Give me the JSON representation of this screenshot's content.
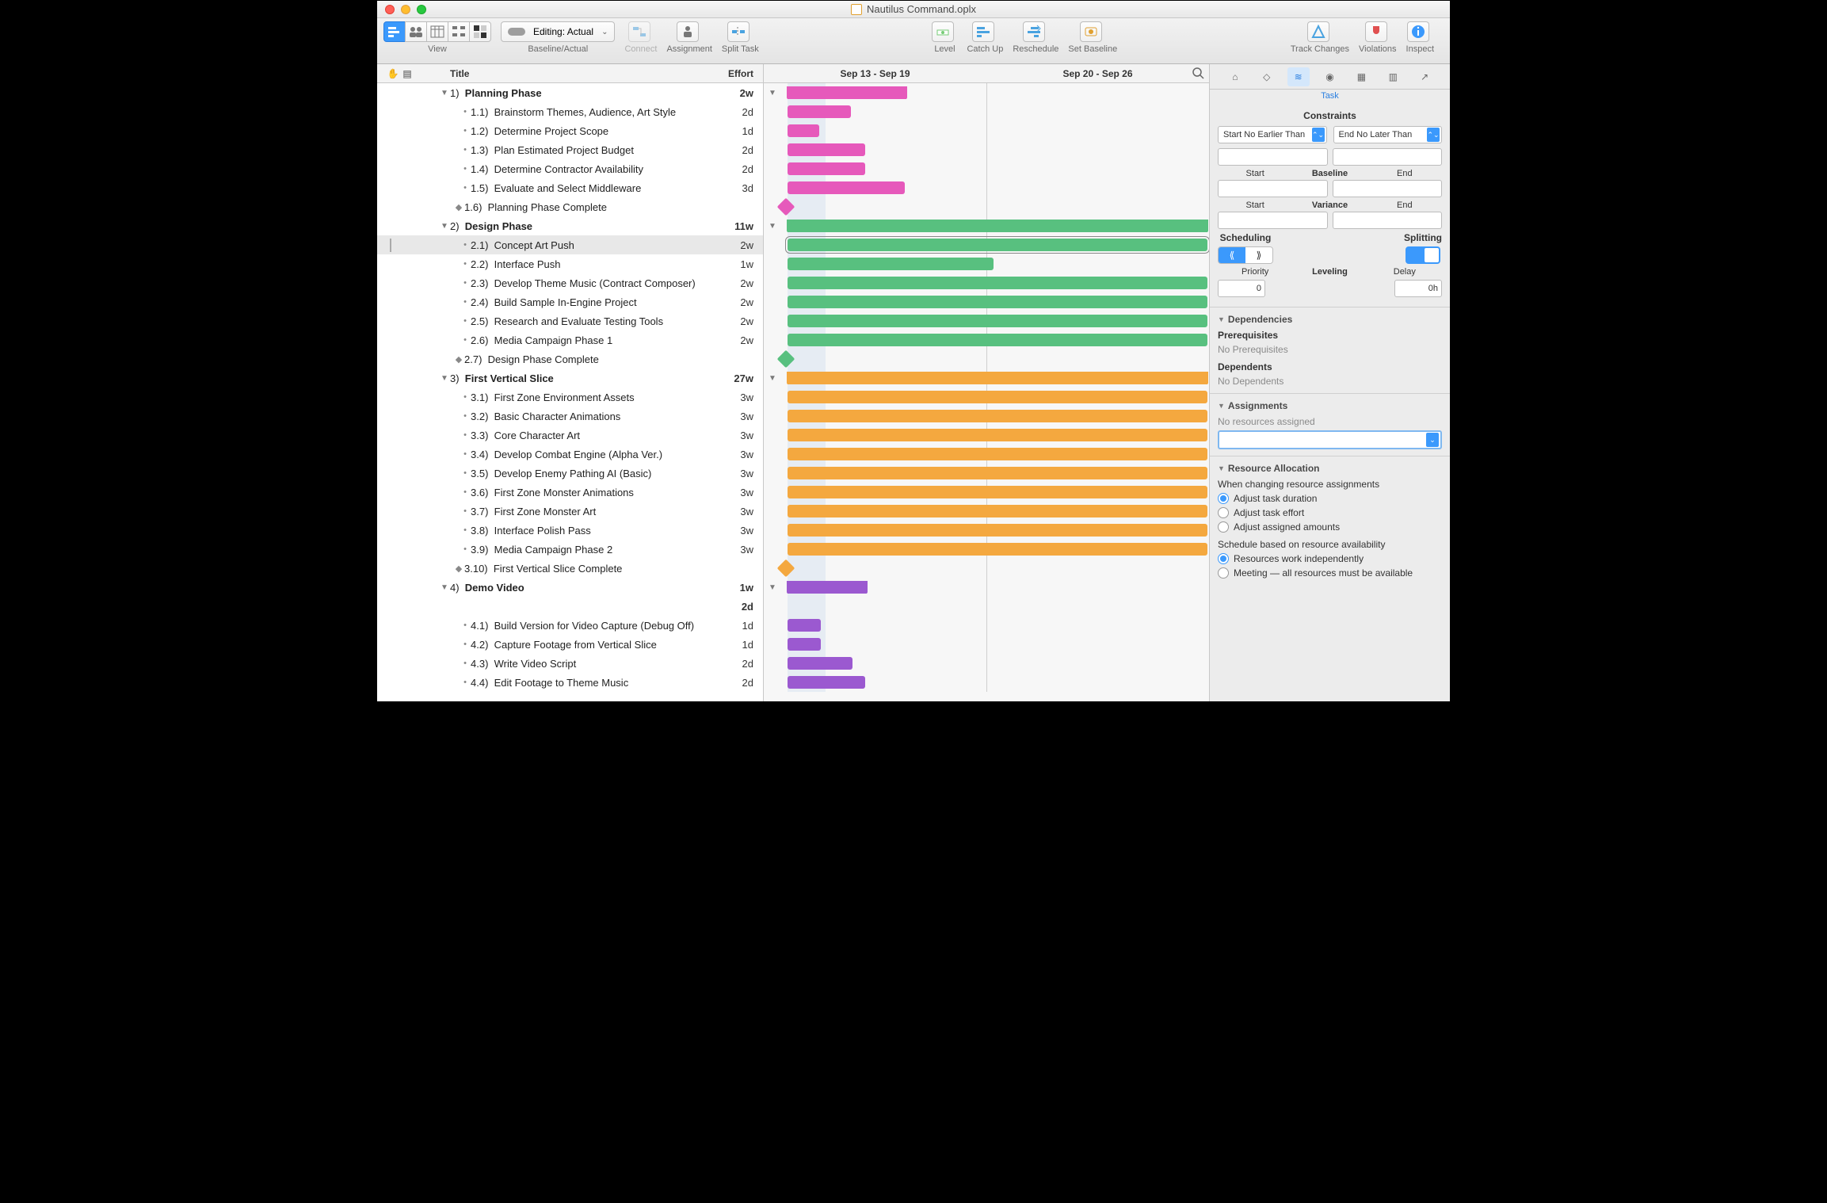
{
  "window": {
    "title": "Nautilus Command.oplx"
  },
  "toolbar": {
    "view_label": "View",
    "baseline_label": "Baseline/Actual",
    "editing_label": "Editing: Actual",
    "connect": "Connect",
    "assignment": "Assignment",
    "split_task": "Split Task",
    "level": "Level",
    "catch_up": "Catch Up",
    "reschedule": "Reschedule",
    "set_baseline": "Set Baseline",
    "track_changes": "Track Changes",
    "violations": "Violations",
    "inspect": "Inspect"
  },
  "outline_header": {
    "title": "Title",
    "effort": "Effort"
  },
  "gantt_header": {
    "left": "Sep 13 - Sep 19",
    "right": "Sep 20 - Sep 26"
  },
  "tasks": [
    {
      "type": "group",
      "num": "1)",
      "title": "Planning Phase",
      "effort": "2w",
      "color": "pink",
      "barStart": 30,
      "barEnd": 180
    },
    {
      "type": "task",
      "num": "1.1)",
      "title": "Brainstorm Themes, Audience, Art Style",
      "effort": "2d",
      "color": "pink",
      "barStart": 30,
      "barEnd": 110
    },
    {
      "type": "task",
      "num": "1.2)",
      "title": "Determine Project Scope",
      "effort": "1d",
      "color": "pink",
      "barStart": 30,
      "barEnd": 70
    },
    {
      "type": "task",
      "num": "1.3)",
      "title": "Plan Estimated Project Budget",
      "effort": "2d",
      "color": "pink",
      "barStart": 30,
      "barEnd": 128
    },
    {
      "type": "task",
      "num": "1.4)",
      "title": "Determine Contractor Availability",
      "effort": "2d",
      "color": "pink",
      "barStart": 30,
      "barEnd": 128
    },
    {
      "type": "task",
      "num": "1.5)",
      "title": "Evaluate and Select Middleware",
      "effort": "3d",
      "color": "pink",
      "barStart": 30,
      "barEnd": 178
    },
    {
      "type": "milestone",
      "num": "1.6)",
      "title": "Planning Phase Complete",
      "effort": "",
      "color": "pink",
      "barStart": 20
    },
    {
      "type": "group",
      "num": "2)",
      "title": "Design Phase",
      "effort": "11w",
      "color": "green",
      "barStart": 30,
      "barEnd": 560
    },
    {
      "type": "task",
      "num": "2.1)",
      "title": "Concept Art Push",
      "effort": "2w",
      "color": "green",
      "barStart": 30,
      "barEnd": 560,
      "selected": true,
      "note": true
    },
    {
      "type": "task",
      "num": "2.2)",
      "title": "Interface Push",
      "effort": "1w",
      "color": "green",
      "barStart": 30,
      "barEnd": 290
    },
    {
      "type": "task",
      "num": "2.3)",
      "title": "Develop Theme Music (Contract Composer)",
      "effort": "2w",
      "color": "green",
      "barStart": 30,
      "barEnd": 560
    },
    {
      "type": "task",
      "num": "2.4)",
      "title": "Build Sample In-Engine Project",
      "effort": "2w",
      "color": "green",
      "barStart": 30,
      "barEnd": 560
    },
    {
      "type": "task",
      "num": "2.5)",
      "title": "Research and Evaluate Testing Tools",
      "effort": "2w",
      "color": "green",
      "barStart": 30,
      "barEnd": 560
    },
    {
      "type": "task",
      "num": "2.6)",
      "title": "Media Campaign Phase 1",
      "effort": "2w",
      "color": "green",
      "barStart": 30,
      "barEnd": 560
    },
    {
      "type": "milestone",
      "num": "2.7)",
      "title": "Design Phase Complete",
      "effort": "",
      "color": "green",
      "barStart": 20
    },
    {
      "type": "group",
      "num": "3)",
      "title": "First Vertical Slice",
      "effort": "27w",
      "color": "orange",
      "barStart": 30,
      "barEnd": 560
    },
    {
      "type": "task",
      "num": "3.1)",
      "title": "First Zone Environment Assets",
      "effort": "3w",
      "color": "orange",
      "barStart": 30,
      "barEnd": 560
    },
    {
      "type": "task",
      "num": "3.2)",
      "title": "Basic Character Animations",
      "effort": "3w",
      "color": "orange",
      "barStart": 30,
      "barEnd": 560
    },
    {
      "type": "task",
      "num": "3.3)",
      "title": "Core Character Art",
      "effort": "3w",
      "color": "orange",
      "barStart": 30,
      "barEnd": 560
    },
    {
      "type": "task",
      "num": "3.4)",
      "title": "Develop Combat Engine (Alpha Ver.)",
      "effort": "3w",
      "color": "orange",
      "barStart": 30,
      "barEnd": 560
    },
    {
      "type": "task",
      "num": "3.5)",
      "title": "Develop Enemy Pathing AI (Basic)",
      "effort": "3w",
      "color": "orange",
      "barStart": 30,
      "barEnd": 560
    },
    {
      "type": "task",
      "num": "3.6)",
      "title": "First Zone Monster Animations",
      "effort": "3w",
      "color": "orange",
      "barStart": 30,
      "barEnd": 560
    },
    {
      "type": "task",
      "num": "3.7)",
      "title": "First Zone Monster Art",
      "effort": "3w",
      "color": "orange",
      "barStart": 30,
      "barEnd": 560
    },
    {
      "type": "task",
      "num": "3.8)",
      "title": "Interface Polish Pass",
      "effort": "3w",
      "color": "orange",
      "barStart": 30,
      "barEnd": 560
    },
    {
      "type": "task",
      "num": "3.9)",
      "title": "Media Campaign Phase 2",
      "effort": "3w",
      "color": "orange",
      "barStart": 30,
      "barEnd": 560
    },
    {
      "type": "milestone",
      "num": "3.10)",
      "title": "First Vertical Slice Complete",
      "effort": "",
      "color": "orange",
      "barStart": 20
    },
    {
      "type": "group",
      "num": "4)",
      "title": "Demo Video",
      "effort": "1w 2d",
      "color": "purple",
      "barStart": 30,
      "barEnd": 130,
      "effort2": true
    },
    {
      "type": "task",
      "num": "4.1)",
      "title": "Build Version for Video Capture (Debug Off)",
      "effort": "1d",
      "color": "purple",
      "barStart": 30,
      "barEnd": 72
    },
    {
      "type": "task",
      "num": "4.2)",
      "title": "Capture Footage from Vertical Slice",
      "effort": "1d",
      "color": "purple",
      "barStart": 30,
      "barEnd": 72
    },
    {
      "type": "task",
      "num": "4.3)",
      "title": "Write Video Script",
      "effort": "2d",
      "color": "purple",
      "barStart": 30,
      "barEnd": 112
    },
    {
      "type": "task",
      "num": "4.4)",
      "title": "Edit Footage to Theme Music",
      "effort": "2d",
      "color": "purple",
      "barStart": 30,
      "barEnd": 128
    }
  ],
  "inspector": {
    "tab_label": "Task",
    "constraints": {
      "title": "Constraints",
      "start_dd": "Start No Earlier Than",
      "end_dd": "End No Later Than",
      "start": "Start",
      "baseline": "Baseline",
      "end": "End",
      "variance": "Variance",
      "scheduling": "Scheduling",
      "splitting": "Splitting",
      "priority": "Priority",
      "leveling": "Leveling",
      "delay": "Delay",
      "priority_val": "0",
      "delay_val": "0h"
    },
    "deps": {
      "title": "Dependencies",
      "prereq": "Prerequisites",
      "noprereq": "No Prerequisites",
      "dep": "Dependents",
      "nodep": "No Dependents"
    },
    "assign": {
      "title": "Assignments",
      "none": "No resources assigned"
    },
    "resalloc": {
      "title": "Resource Allocation",
      "when": "When changing resource assignments",
      "r1": "Adjust task duration",
      "r2": "Adjust task effort",
      "r3": "Adjust assigned amounts",
      "sched": "Schedule based on resource availability",
      "r4": "Resources work independently",
      "r5": "Meeting — all resources must be available"
    }
  }
}
